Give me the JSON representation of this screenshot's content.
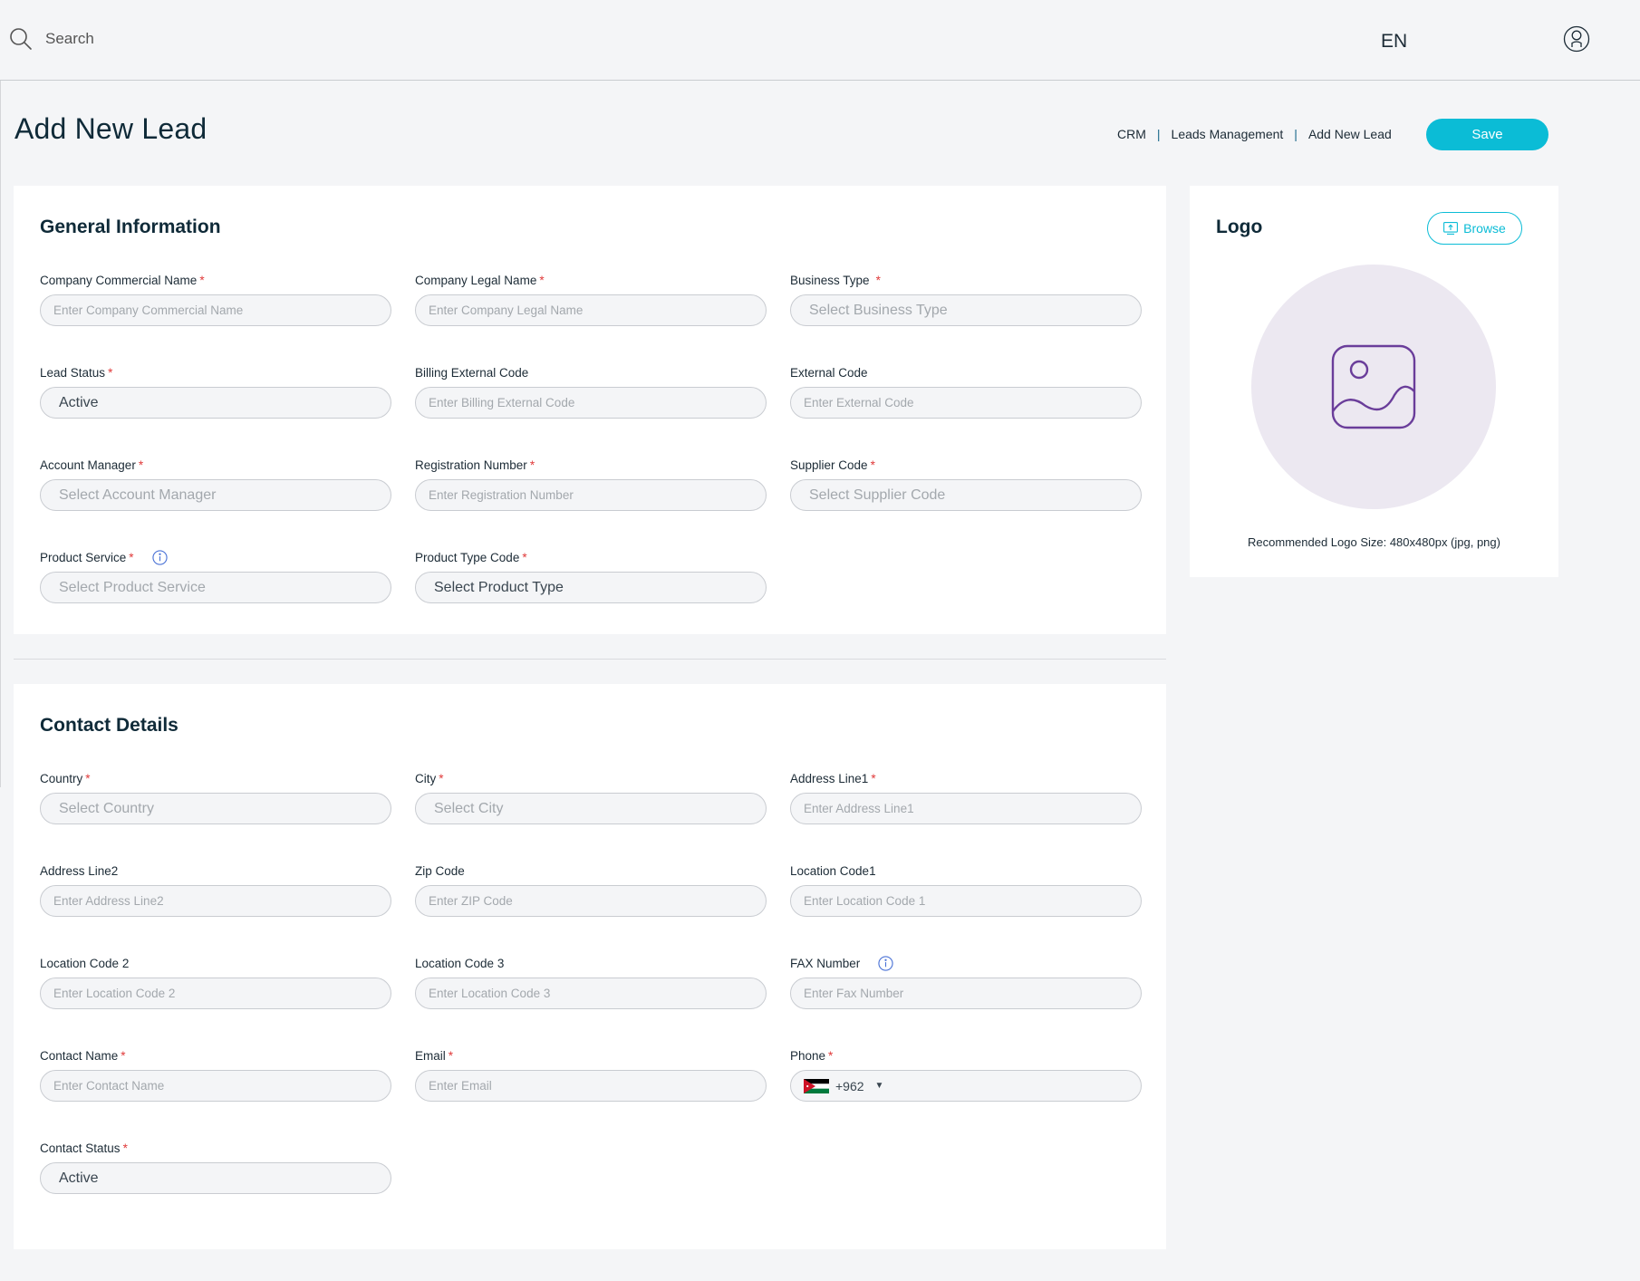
{
  "topbar": {
    "search_placeholder": "Search",
    "language": "EN",
    "search_icon": "search-icon",
    "user_icon": "user-icon"
  },
  "page": {
    "title": "Add New Lead",
    "breadcrumb": [
      "CRM",
      "Leads Management",
      "Add New Lead"
    ],
    "breadcrumb_separator": "|",
    "save_label": "Save"
  },
  "general": {
    "title": "General Information",
    "fields": {
      "company_commercial_name": {
        "label": "Company Commercial Name",
        "required": "*",
        "placeholder": "Enter Company Commercial Name"
      },
      "company_legal_name": {
        "label": "Company Legal Name",
        "required": "*",
        "placeholder": "Enter Company Legal Name"
      },
      "business_type": {
        "label": "Business Type",
        "required": "*",
        "placeholder": "Select Business Type"
      },
      "lead_status": {
        "label": "Lead Status",
        "required": "*",
        "value": "Active"
      },
      "billing_external_code": {
        "label": "Billing External Code",
        "placeholder": "Enter Billing External Code"
      },
      "external_code": {
        "label": "External Code",
        "placeholder": "Enter External Code"
      },
      "account_manager": {
        "label": "Account Manager",
        "required": "*",
        "placeholder": "Select Account Manager"
      },
      "registration_number": {
        "label": "Registration Number",
        "required": "*",
        "placeholder": "Enter Registration Number"
      },
      "supplier_code": {
        "label": "Supplier Code",
        "required": "*",
        "placeholder": "Select Supplier Code"
      },
      "product_service": {
        "label": "Product Service",
        "required": "*",
        "placeholder": "Select Product Service"
      },
      "product_type_code": {
        "label": "Product Type Code",
        "required": "*",
        "placeholder": "Select Product Type"
      }
    }
  },
  "logo": {
    "title": "Logo",
    "browse_label": "Browse",
    "hint": "Recommended Logo Size: 480x480px (jpg, png)",
    "placeholder_icon": "image-icon"
  },
  "contact": {
    "title": "Contact Details",
    "fields": {
      "country": {
        "label": "Country",
        "required": "*",
        "placeholder": "Select Country"
      },
      "city": {
        "label": "City",
        "required": "*",
        "placeholder": "Select City"
      },
      "address_line1": {
        "label": "Address Line1",
        "required": "*",
        "placeholder": "Enter Address Line1"
      },
      "address_line2": {
        "label": "Address Line2",
        "placeholder": "Enter Address Line2"
      },
      "zip_code": {
        "label": "Zip Code",
        "placeholder": "Enter ZIP Code"
      },
      "location_code1": {
        "label": "Location Code1",
        "placeholder": "Enter Location Code 1"
      },
      "location_code2": {
        "label": "Location Code 2",
        "placeholder": "Enter Location Code 2"
      },
      "location_code3": {
        "label": "Location Code 3",
        "placeholder": "Enter Location Code 3"
      },
      "fax_number": {
        "label": "FAX Number",
        "placeholder": "Enter Fax Number"
      },
      "contact_name": {
        "label": "Contact Name",
        "required": "*",
        "placeholder": "Enter Contact Name"
      },
      "email": {
        "label": "Email",
        "required": "*",
        "placeholder": "Enter Email"
      },
      "phone": {
        "label": "Phone",
        "required": "*",
        "country_code": "+962",
        "flag_icon": "jordan-flag-icon"
      },
      "contact_status": {
        "label": "Contact Status",
        "required": "*",
        "value": "Active"
      }
    }
  },
  "colors": {
    "accent": "#0bbcd6",
    "required": "#e03a3a",
    "info_icon": "#4a72d6",
    "logo_icon": "#6a3d9a",
    "logo_bg": "#ece8f1"
  }
}
